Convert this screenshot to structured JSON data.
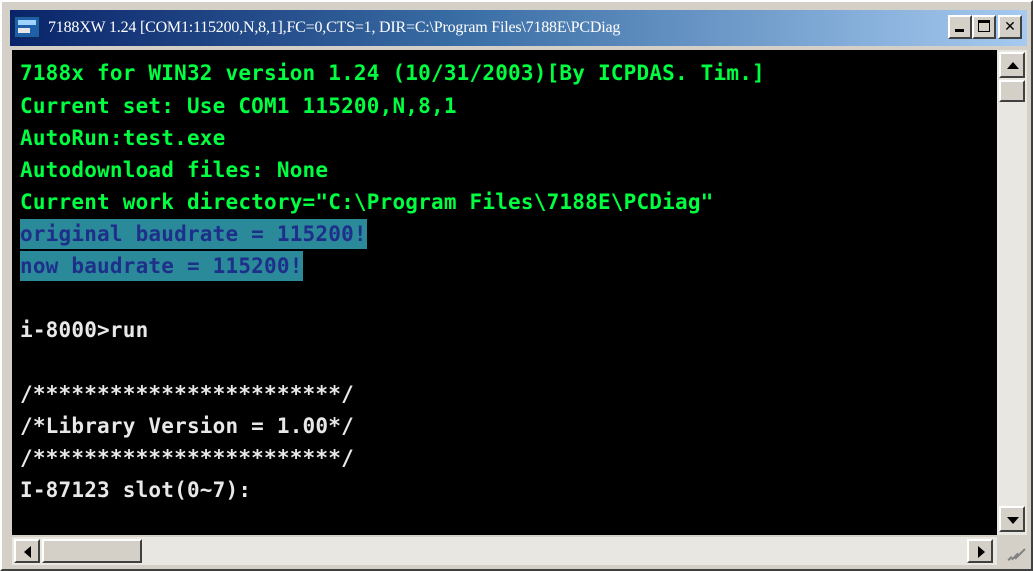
{
  "window": {
    "title": "7188XW 1.24 [COM1:115200,N,8,1],FC=0,CTS=1, DIR=C:\\Program Files\\7188E\\PCDiag",
    "controls": {
      "minimize": "_",
      "maximize": "□",
      "close": "✕"
    }
  },
  "console": {
    "lines": [
      "7188x for WIN32 version 1.24 (10/31/2003)[By ICPDAS. Tim.]",
      "Current set: Use COM1 115200,N,8,1",
      "AutoRun:test.exe",
      "Autodownload files: None",
      "Current work directory=\"C:\\Program Files\\7188E\\PCDiag\"",
      "original baudrate = 115200!",
      "now baudrate = 115200!",
      "",
      "i-8000>run",
      "",
      "/************************/",
      "/*Library Version = 1.00*/",
      "/************************/",
      "I-87123 slot(0~7):"
    ]
  },
  "colors": {
    "console_bg": "#000000",
    "green_text": "#00ff40",
    "highlight_bg": "#2a8a9a",
    "highlight_text": "#1e2f8a",
    "white_text": "#e8e8e8",
    "titlebar_start": "#0a246a",
    "titlebar_end": "#a6caf0"
  },
  "icons": [
    "app-icon",
    "minimize-icon",
    "maximize-icon",
    "close-icon",
    "scroll-up-arrow-icon",
    "scroll-down-arrow-icon",
    "scroll-left-arrow-icon",
    "scroll-right-arrow-icon",
    "resize-grip-icon"
  ]
}
